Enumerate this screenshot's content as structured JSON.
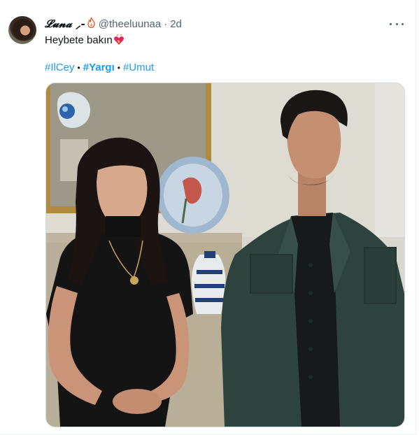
{
  "tweet": {
    "display_name": "𝓛𝓾𝓷𝓪 ⸝-",
    "handle": "@theeluunaa",
    "separator": "·",
    "timestamp": "2d",
    "text": "Heybete bakın",
    "hashtags": [
      {
        "label": "#IlCey",
        "bold": false
      },
      {
        "label": "#Yargı",
        "bold": true
      },
      {
        "label": "#Umut",
        "bold": false
      }
    ],
    "hashtag_separator": "•"
  },
  "icons": {
    "more": "more-horizontal-icon",
    "name_emoji": "flame-icon",
    "text_emoji": "heart-on-fire-icon",
    "channel_logo": "kanal-d-logo"
  },
  "colors": {
    "link": "#1d9bf0",
    "secondary_text": "#536471",
    "primary_text": "#0f1419"
  }
}
